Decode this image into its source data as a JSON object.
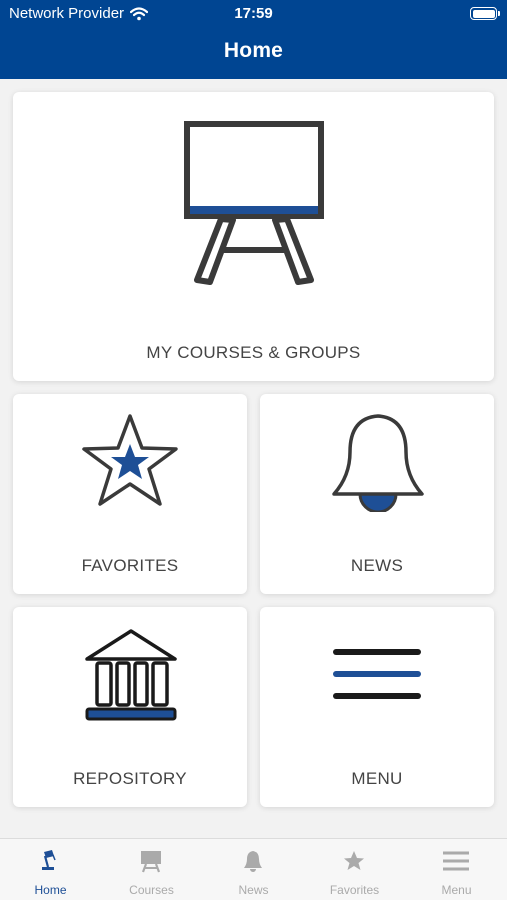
{
  "status_bar": {
    "carrier": "Network Provider",
    "time": "17:59"
  },
  "header": {
    "title": "Home"
  },
  "tiles": {
    "courses": {
      "label": "MY COURSES & GROUPS",
      "icon": "easel-board-icon"
    },
    "favorites": {
      "label": "FAVORITES",
      "icon": "star-icon"
    },
    "news": {
      "label": "NEWS",
      "icon": "bell-icon"
    },
    "repository": {
      "label": "REPOSITORY",
      "icon": "institution-building-icon"
    },
    "menu": {
      "label": "MENU",
      "icon": "hamburger-menu-icon"
    }
  },
  "tabbar": {
    "items": [
      {
        "label": "Home",
        "icon": "desk-lamp-icon",
        "active": true
      },
      {
        "label": "Courses",
        "icon": "easel-board-icon",
        "active": false
      },
      {
        "label": "News",
        "icon": "bell-icon",
        "active": false
      },
      {
        "label": "Favorites",
        "icon": "star-icon",
        "active": false
      },
      {
        "label": "Menu",
        "icon": "hamburger-menu-icon",
        "active": false
      }
    ]
  },
  "colors": {
    "header_bg": "#004592",
    "accent_blue": "#1e4f96",
    "icon_dark": "#3a3a3a",
    "tab_inactive": "#aaaaaa"
  }
}
